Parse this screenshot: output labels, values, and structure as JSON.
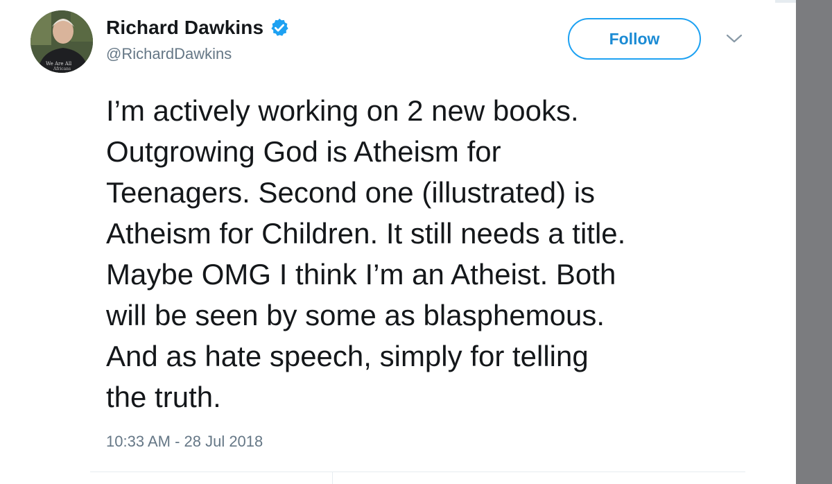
{
  "author": {
    "display_name": "Richard Dawkins",
    "handle": "@RichardDawkins",
    "verified": true,
    "avatar_shirt_text": [
      "We Are All",
      "Africans"
    ]
  },
  "actions": {
    "follow_label": "Follow",
    "menu_icon": "chevron-down-icon"
  },
  "tweet": {
    "lines": [
      "I’m actively working on 2 new books.",
      "Outgrowing God is Atheism for",
      "Teenagers. Second one (illustrated) is",
      "Atheism for Children. It still needs a title.",
      "Maybe OMG I think I’m an Atheist. Both",
      "will be seen by some as blasphemous.",
      "And as hate speech, simply for telling",
      "the truth."
    ],
    "timestamp": "10:33 AM - 28 Jul 2018"
  },
  "colors": {
    "accent": "#1da1f2",
    "text": "#14171a",
    "secondary_text": "#657786",
    "scrollbar": "#7b7c7f"
  }
}
